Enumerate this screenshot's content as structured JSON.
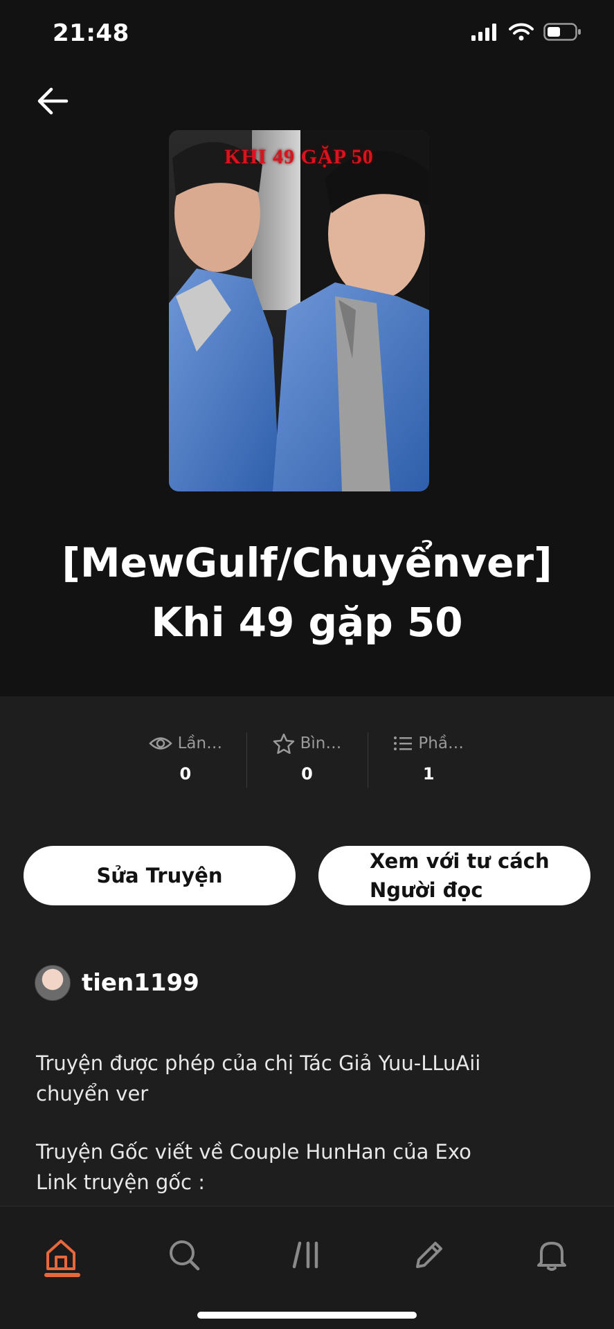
{
  "status_bar": {
    "time": "21:48"
  },
  "cover": {
    "title": "KHI 49 GẶP 50"
  },
  "book": {
    "title": "[MewGulf/Chuyểnver] Khi 49 gặp 50"
  },
  "stats": [
    {
      "icon": "eye-icon",
      "label": "Lần…",
      "value": "0"
    },
    {
      "icon": "star-icon",
      "label": "Bìn…",
      "value": "0"
    },
    {
      "icon": "list-icon",
      "label": "Phầ…",
      "value": "1"
    }
  ],
  "actions": {
    "edit_label": "Sửa Truyện",
    "reader_label_line1": "Xem với tư cách",
    "reader_label_line2": "Người đọc"
  },
  "author": {
    "username": "tien1199"
  },
  "description": {
    "paragraph1": "Truyện được phép của chị Tác Giả Yuu-LLuAii\nchuyển ver",
    "paragraph2": "Truyện Gốc viết về Couple HunHan của Exo\nLink truyện gốc :"
  },
  "colors": {
    "accent": "#e8683c",
    "background": "#121212",
    "panel": "#1e1e1e"
  },
  "bottom_nav": {
    "items": [
      "home-icon",
      "search-icon",
      "library-icon",
      "pencil-icon",
      "bell-icon"
    ],
    "active": "home-icon"
  }
}
